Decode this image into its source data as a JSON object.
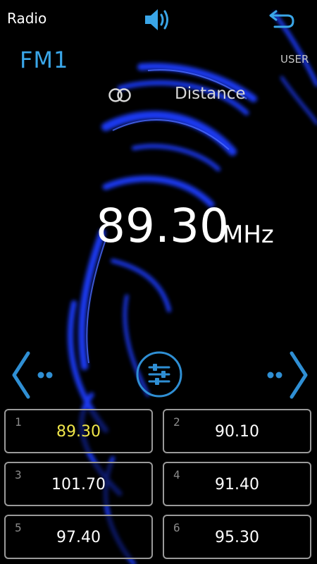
{
  "header": {
    "title": "Radio",
    "volume_icon": "speaker-volume-icon",
    "back_icon": "back-arrow-icon"
  },
  "band": {
    "label": "FM1",
    "mode": "USER"
  },
  "status": {
    "stereo_icon": "stereo-rings-icon",
    "distance_label": "Distance"
  },
  "tuner": {
    "frequency": "89.30",
    "unit": "MHz"
  },
  "controls": {
    "prev_icon": "chevron-left-icon",
    "next_icon": "chevron-right-icon",
    "eq_icon": "equalizer-sliders-icon"
  },
  "presets": [
    {
      "number": "1",
      "frequency": "89.30",
      "active": true
    },
    {
      "number": "2",
      "frequency": "90.10",
      "active": false
    },
    {
      "number": "3",
      "frequency": "101.70",
      "active": false
    },
    {
      "number": "4",
      "frequency": "91.40",
      "active": false
    },
    {
      "number": "5",
      "frequency": "97.40",
      "active": false
    },
    {
      "number": "6",
      "frequency": "95.30",
      "active": false
    }
  ],
  "colors": {
    "accent": "#3aa6e8",
    "active_preset": "#f0e64a",
    "background_glow": "#1e3cff"
  }
}
